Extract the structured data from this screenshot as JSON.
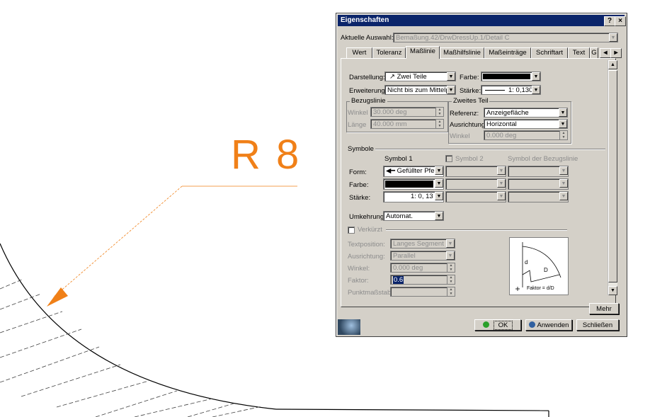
{
  "drawing": {
    "dimension_text": "R 8",
    "colors": {
      "dimension": "#f08018",
      "geometry": "#000000",
      "hatch": "#404040"
    }
  },
  "dialog": {
    "title": "Eigenschaften",
    "help_btn": "?",
    "close_btn": "×",
    "selection_label": "Aktuelle Auswahl:",
    "selection_value": "Bemaßung.42/DrwDressUp.1/Detail C",
    "tabs": [
      "Wert",
      "Toleranz",
      "Maßlinie",
      "Maßhilfslinie",
      "Maßeinträge",
      "Schriftart",
      "Text",
      "G"
    ],
    "active_tab": "Maßlinie",
    "darstellung_label": "Darstellung:",
    "darstellung_value": "Zwei Teile",
    "erweiterung_label": "Erweiterung:",
    "erweiterung_value": "Nicht bis zum Mittelpunkt",
    "farbe_label": "Farbe:",
    "staerke_label": "Stärke:",
    "staerke_value": "1: 0,130",
    "bezugslinie": {
      "title": "Bezugslinie",
      "winkel_label": "Winkel",
      "winkel_value": "30.000 deg",
      "laenge_label": "Länge",
      "laenge_value": "40.000 mm"
    },
    "zweites_teil": {
      "title": "Zweites Teil",
      "referenz_label": "Referenz:",
      "referenz_value": "Anzeigefläche",
      "ausrichtung_label": "Ausrichtung:",
      "ausrichtung_value": "Horizontal",
      "winkel_label": "Winkel",
      "winkel_value": "0.000 deg"
    },
    "symbole": {
      "title": "Symbole",
      "col1": "Symbol 1",
      "col2": "Symbol 2",
      "col3": "Symbol der Bezugslinie",
      "form_label": "Form:",
      "form_value": "Gefüllter Pfeil",
      "farbe_label": "Farbe:",
      "staerke_label": "Stärke:",
      "staerke_value": "1: 0, 13"
    },
    "umkehrung_label": "Umkehrung:",
    "umkehrung_value": "Automat.",
    "verkuerzt": {
      "label": "Verkürzt",
      "textposition_label": "Textposition:",
      "textposition_value": "Langes Segment",
      "ausrichtung_label": "Ausrichtung:",
      "ausrichtung_value": "Parallel",
      "winkel_label": "Winkel:",
      "winkel_value": "0.000 deg",
      "faktor_label": "Faktor:",
      "faktor_value": "0.6",
      "punktmassstab_label": "Punktmaßstab"
    },
    "preview": {
      "d": "d",
      "D": "D",
      "caption": "Faktor = d/D"
    },
    "buttons": {
      "mehr": "Mehr",
      "ok": "OK",
      "anwenden": "Anwenden",
      "schliessen": "Schließen"
    },
    "colors": {
      "titlebar": "#0a246a",
      "face": "#d4d0c8",
      "ok_icon": "#2aa02a",
      "apply_icon": "#3060a0"
    }
  }
}
